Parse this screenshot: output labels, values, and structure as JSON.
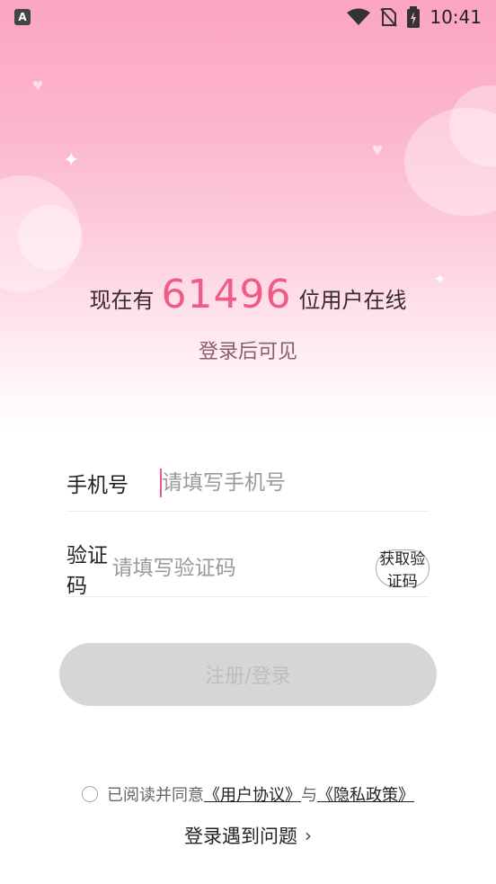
{
  "status_bar": {
    "app_badge": "A",
    "time": "10:41"
  },
  "hero": {
    "prefix": "现在有",
    "online_count": "61496",
    "suffix": "位用户在线",
    "subtitle": "登录后可见"
  },
  "form": {
    "phone_label": "手机号",
    "phone_placeholder": "请填写手机号",
    "phone_value": "",
    "code_label": "验证码",
    "code_placeholder": "请填写验证码",
    "code_value": "",
    "get_code_label": "获取验证码",
    "submit_label": "注册/登录"
  },
  "agreement": {
    "checked": false,
    "text": "已阅读并同意",
    "user_agreement": "《用户协议》",
    "and": "与",
    "privacy_policy": "《隐私政策》"
  },
  "help": {
    "label": "登录遇到问题"
  },
  "colors": {
    "accent": "#f05b85",
    "button_disabled": "#d6d6d6"
  }
}
